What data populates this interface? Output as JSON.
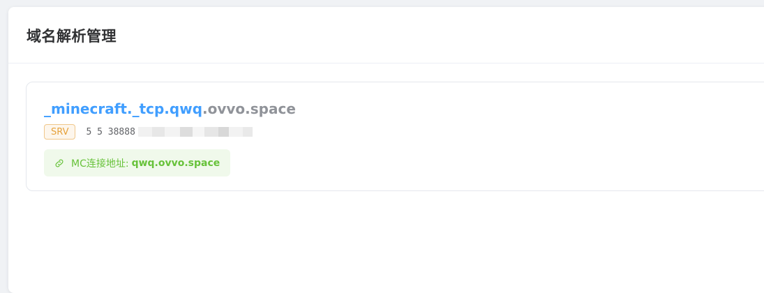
{
  "page": {
    "title": "域名解析管理"
  },
  "record": {
    "subdomain": "_minecraft._tcp.qwq",
    "root_domain": ".ovvo.space",
    "type": "SRV",
    "value": "5 5 38888",
    "connect_label": "MC连接地址:",
    "connect_address": "qwq.ovvo.space",
    "connect_icon": "link-icon"
  },
  "colors": {
    "subdomain": "#409eff",
    "root_domain": "#909399",
    "srv_tag": "#e6a23c",
    "connect_text": "#67c23a",
    "connect_bg": "#f0f9eb"
  }
}
